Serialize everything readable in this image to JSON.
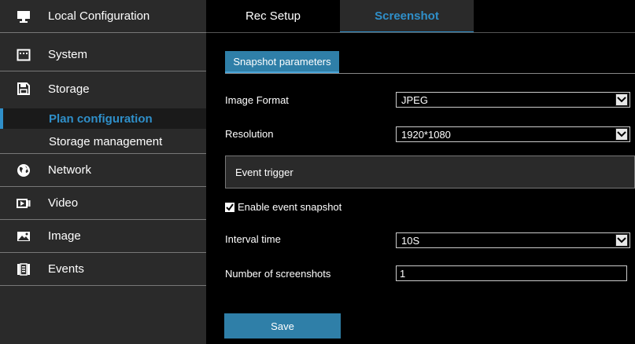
{
  "sidebar": {
    "items": [
      {
        "label": "Local Configuration",
        "icon": "monitor-icon"
      },
      {
        "label": "System",
        "icon": "system-icon"
      },
      {
        "label": "Storage",
        "icon": "floppy-disk-icon"
      },
      {
        "label": "Network",
        "icon": "globe-icon"
      },
      {
        "label": "Video",
        "icon": "video-icon"
      },
      {
        "label": "Image",
        "icon": "image-icon"
      },
      {
        "label": "Events",
        "icon": "events-icon"
      }
    ],
    "sub_items": [
      {
        "label": "Plan configuration",
        "active": true
      },
      {
        "label": "Storage management",
        "active": false
      }
    ]
  },
  "tabs": [
    {
      "label": "Rec Setup",
      "active": false
    },
    {
      "label": "Screenshot",
      "active": true
    }
  ],
  "content": {
    "section_title": "Snapshot parameters",
    "image_format": {
      "label": "Image Format",
      "value": "JPEG"
    },
    "resolution": {
      "label": "Resolution",
      "value": "1920*1080"
    },
    "event_trigger_title": "Event trigger",
    "enable_event_snapshot": {
      "label": "Enable event snapshot",
      "checked": true
    },
    "interval_time": {
      "label": "Interval time",
      "value": "10S"
    },
    "number_of_screenshots": {
      "label": "Number of screenshots",
      "value": "1"
    },
    "save_label": "Save"
  },
  "colors": {
    "accent": "#2f8fc9",
    "button": "#2f7fa8",
    "sidebar_bg": "#2a2a2a",
    "background": "#000000"
  }
}
